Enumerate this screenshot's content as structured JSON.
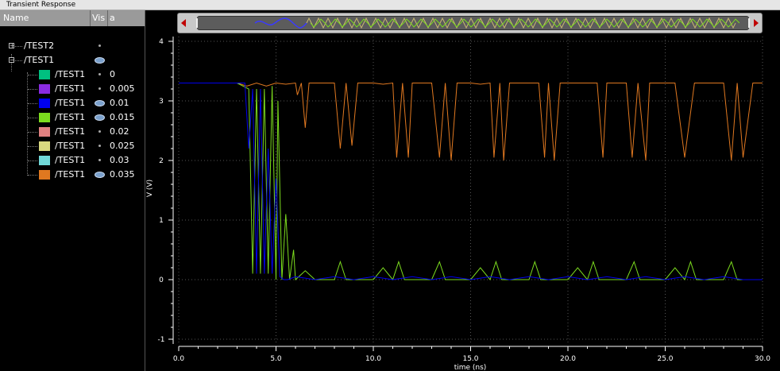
{
  "window": {
    "title": "Transient Response"
  },
  "panel": {
    "col_name": "Name",
    "col_vis": "Vis",
    "col_a": "a",
    "groups": [
      {
        "label": "/TEST2",
        "expanded": false,
        "vis": "dot"
      },
      {
        "label": "/TEST1",
        "expanded": true,
        "vis": "eye"
      }
    ],
    "signals": [
      {
        "label": "/TEST1",
        "color": "#00c080",
        "vis": "dot",
        "value": "0"
      },
      {
        "label": "/TEST1",
        "color": "#8a2be2",
        "vis": "dot",
        "value": "0.005"
      },
      {
        "label": "/TEST1",
        "color": "#0000ee",
        "vis": "eye",
        "value": "0.01"
      },
      {
        "label": "/TEST1",
        "color": "#7cdc1e",
        "vis": "eye",
        "value": "0.015"
      },
      {
        "label": "/TEST1",
        "color": "#e08080",
        "vis": "dot",
        "value": "0.02"
      },
      {
        "label": "/TEST1",
        "color": "#d8d880",
        "vis": "dot",
        "value": "0.025"
      },
      {
        "label": "/TEST1",
        "color": "#70d8d8",
        "vis": "dot",
        "value": "0.03"
      },
      {
        "label": "/TEST1",
        "color": "#e07820",
        "vis": "eye",
        "value": "0.035"
      }
    ]
  },
  "chart_data": {
    "type": "line",
    "xlabel": "time (ns)",
    "ylabel": "V (V)",
    "xlim": [
      0,
      30
    ],
    "ylim": [
      -1,
      4
    ],
    "xticks": [
      "0.0",
      "5.0",
      "10.0",
      "15.0",
      "20.0",
      "25.0",
      "30.0"
    ],
    "yticks": [
      "-1",
      "0",
      "1",
      "2",
      "3",
      "4"
    ],
    "grid": true,
    "series": [
      {
        "color": "#e07820",
        "x": [
          0,
          3,
          3.5,
          4,
          4.5,
          5,
          5.5,
          6,
          6.1,
          6.3,
          6.5,
          6.7,
          7,
          8,
          8.3,
          8.6,
          8.9,
          9.2,
          9.6,
          10,
          10.5,
          11,
          11.2,
          11.5,
          11.8,
          12,
          12.5,
          13,
          13.4,
          13.7,
          14,
          14.3,
          14.6,
          15,
          15.5,
          16,
          16.2,
          16.5,
          16.7,
          17,
          17.5,
          18,
          18.5,
          18.8,
          19,
          19.3,
          19.6,
          20,
          20.5,
          21,
          21.5,
          21.8,
          22,
          22.5,
          23,
          23.3,
          23.6,
          24,
          24.2,
          24.5,
          25,
          25.5,
          26,
          26.5,
          27,
          27.5,
          28,
          28.4,
          28.7,
          29,
          29.5,
          30
        ],
        "y": [
          3.3,
          3.3,
          3.25,
          3.3,
          3.25,
          3.3,
          3.28,
          3.3,
          3.1,
          3.3,
          2.55,
          3.3,
          3.3,
          3.3,
          2.2,
          3.3,
          2.25,
          3.3,
          3.3,
          3.3,
          3.28,
          3.3,
          2.05,
          3.3,
          2.05,
          3.3,
          3.3,
          3.3,
          2.05,
          3.3,
          2.0,
          3.3,
          3.3,
          3.3,
          3.28,
          3.3,
          2.05,
          3.3,
          2.0,
          3.3,
          3.3,
          3.3,
          3.3,
          2.05,
          3.3,
          2.0,
          3.3,
          3.3,
          3.3,
          3.3,
          3.3,
          2.05,
          3.3,
          3.3,
          3.3,
          2.05,
          3.3,
          2.0,
          3.3,
          3.3,
          3.3,
          3.3,
          2.05,
          3.3,
          3.3,
          3.3,
          3.3,
          2.0,
          3.3,
          2.05,
          3.3,
          3.3
        ]
      },
      {
        "color": "#7cdc1e",
        "x": [
          0,
          3,
          3.6,
          3.8,
          4.0,
          4.2,
          4.4,
          4.6,
          4.8,
          5.0,
          5.1,
          5.3,
          5.5,
          5.7,
          5.9,
          6.0,
          6.5,
          7,
          8,
          8.3,
          8.6,
          9,
          10,
          10.5,
          11,
          11.3,
          11.6,
          12,
          13,
          13.4,
          13.7,
          14,
          15,
          15.5,
          16,
          16.3,
          16.6,
          17,
          18,
          18.3,
          18.6,
          19,
          20,
          20.5,
          21,
          21.3,
          21.6,
          22,
          23,
          23.4,
          23.7,
          24,
          25,
          25.5,
          26,
          26.3,
          26.6,
          27,
          28,
          28.4,
          28.7,
          29,
          30
        ],
        "y": [
          3.3,
          3.3,
          3.2,
          0.1,
          3.2,
          0.1,
          3.2,
          0.1,
          3.25,
          0.0,
          3.0,
          0.0,
          1.1,
          0.0,
          0.5,
          0.0,
          0.15,
          0.0,
          0.0,
          0.3,
          0.0,
          0.0,
          0.0,
          0.2,
          0.0,
          0.3,
          0.0,
          0.0,
          0.0,
          0.3,
          0.0,
          0.0,
          0.0,
          0.2,
          0.0,
          0.3,
          0.0,
          0.0,
          0.0,
          0.3,
          0.0,
          0.0,
          0.0,
          0.2,
          0.0,
          0.3,
          0.0,
          0.0,
          0.0,
          0.3,
          0.0,
          0.0,
          0.0,
          0.2,
          0.0,
          0.3,
          0.0,
          0.0,
          0.0,
          0.3,
          0.0,
          0.0,
          0.0
        ]
      },
      {
        "color": "#0000ee",
        "x": [
          0,
          3,
          3.4,
          3.6,
          3.8,
          4.0,
          4.2,
          4.4,
          4.6,
          4.8,
          5.0,
          5.2,
          5.4,
          5.6,
          6,
          7,
          8,
          9,
          10,
          11,
          12,
          13,
          14,
          15,
          16,
          17,
          18,
          19,
          20,
          21,
          22,
          23,
          24,
          25,
          26,
          27,
          28,
          29,
          30
        ],
        "y": [
          3.3,
          3.3,
          3.3,
          2.2,
          3.2,
          0.1,
          3.2,
          0.1,
          2.2,
          0.1,
          1.7,
          0.05,
          0.0,
          0.0,
          0.05,
          0.0,
          0.05,
          0.0,
          0.05,
          0.0,
          0.05,
          0.0,
          0.05,
          0.0,
          0.05,
          0.0,
          0.05,
          0.0,
          0.05,
          0.0,
          0.05,
          0.0,
          0.05,
          0.0,
          0.05,
          0.0,
          0.05,
          0.0,
          0.0
        ]
      }
    ]
  }
}
